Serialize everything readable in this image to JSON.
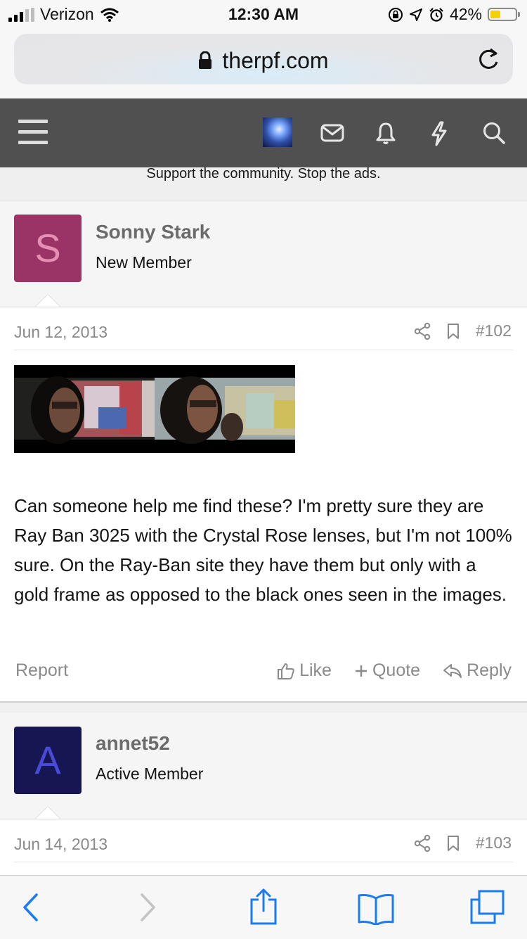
{
  "status": {
    "carrier": "Verizon",
    "time": "12:30 AM",
    "battery": "42%",
    "battery_level": 0.42
  },
  "browser": {
    "url": "therpf.com"
  },
  "site": {
    "banner": "Support the community. Stop the ads."
  },
  "posts": [
    {
      "author": "Sonny Stark",
      "initial": "S",
      "role": "New Member",
      "avatar_color": "#9b3466",
      "avatar_text_color": "#e58fb5",
      "date": "Jun 12, 2013",
      "number": "#102",
      "text": "Can someone help me find these? I'm pretty sure they are Ray Ban 3025 with the Crystal Rose lenses, but I'm not 100% sure. On the Ray-Ban site they have them but only with a gold frame as opposed to the black ones seen in the images.",
      "report_label": "Report",
      "like_label": "Like",
      "quote_label": "Quote",
      "reply_label": "Reply"
    },
    {
      "author": "annet52",
      "initial": "A",
      "role": "Active Member",
      "avatar_color": "#161653",
      "avatar_text_color": "#4a4ad8",
      "date": "Jun 14, 2013",
      "number": "#103"
    }
  ]
}
